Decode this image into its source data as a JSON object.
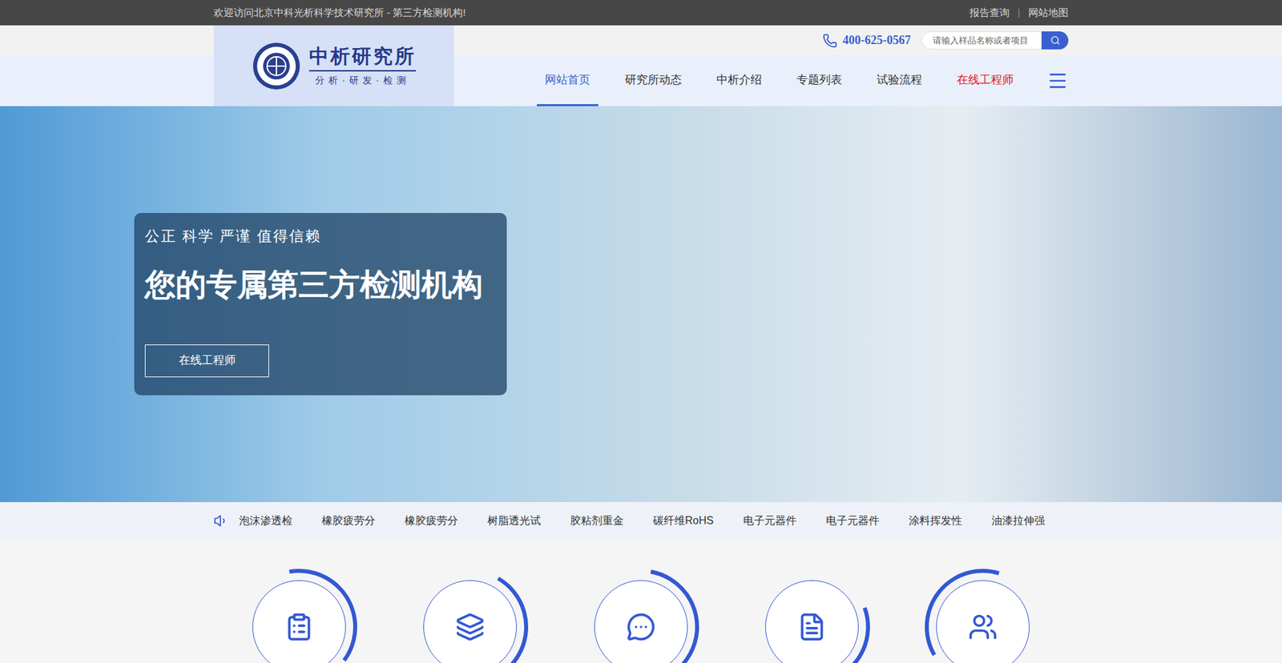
{
  "topbar": {
    "welcome": "欢迎访问北京中科光析科学技术研究所 - 第三方检测机构!",
    "links": [
      "报告查询",
      "网站地图"
    ],
    "separator": "|"
  },
  "header": {
    "logo": {
      "title": "中析研究所",
      "subtitle": "分析·研发·检测"
    },
    "phone": "400-625-0567",
    "search": {
      "placeholder": "请输入样品名称或者项目"
    },
    "nav": [
      {
        "label": "网站首页",
        "selected": true,
        "kind": "normal"
      },
      {
        "label": "研究所动态",
        "selected": false,
        "kind": "normal"
      },
      {
        "label": "中析介绍",
        "selected": false,
        "kind": "normal"
      },
      {
        "label": "专题列表",
        "selected": false,
        "kind": "normal"
      },
      {
        "label": "试验流程",
        "selected": false,
        "kind": "normal"
      },
      {
        "label": "在线工程师",
        "selected": false,
        "kind": "hot"
      }
    ]
  },
  "hero": {
    "tagline": "公正 科学 严谨 值得信赖",
    "headline": "您的专属第三方检测机构",
    "button": "在线工程师"
  },
  "ticker": {
    "items": [
      "泡沫渗透检",
      "橡胶疲劳分",
      "橡胶疲劳分",
      "树脂透光试",
      "胶粘剂重金",
      "碳纤维RoHS",
      "电子元器件",
      "电子元器件",
      "涂料挥发性",
      "油漆拉伸强"
    ]
  }
}
